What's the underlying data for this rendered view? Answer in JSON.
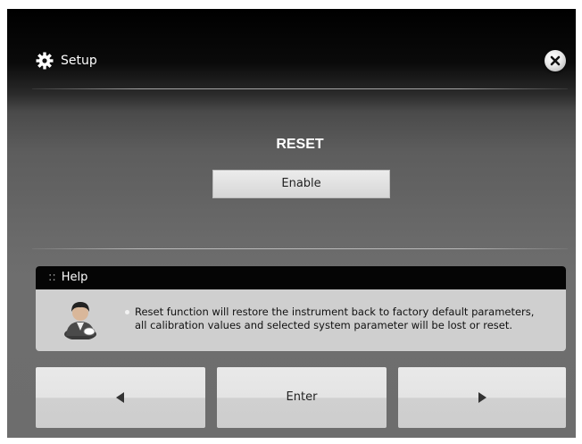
{
  "header": {
    "title": "Setup",
    "icon": "gear-icon",
    "close_icon": "close-icon"
  },
  "main": {
    "section_label": "RESET",
    "enable_label": "Enable"
  },
  "help": {
    "heading_prefix": "::",
    "heading": "Help",
    "avatar_icon": "user-avatar-icon",
    "text_line1": "Reset function will restore the instrument back to factory default parameters,",
    "text_line2": "all calibration values and selected system parameter will be lost or reset."
  },
  "navigation": {
    "prev_icon": "arrow-left-icon",
    "enter_label": "Enter",
    "next_icon": "arrow-right-icon"
  },
  "colors": {
    "header_bg": "#000000",
    "help_head_bg": "#050505",
    "help_body_bg": "#cfcfcf",
    "button_bg": "#e4e4e4"
  }
}
